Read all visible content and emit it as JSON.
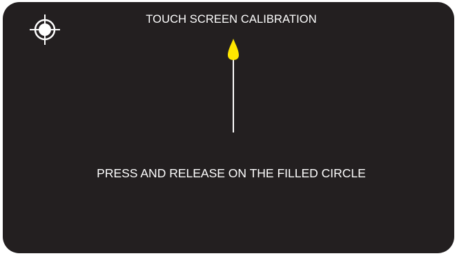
{
  "screen": {
    "title": "TOUCH SCREEN CALIBRATION",
    "instruction": "PRESS AND RELEASE ON THE FILLED CIRCLE",
    "target_icon": "crosshair-filled-circle-icon",
    "pointer_icon": "up-arrow-icon"
  },
  "colors": {
    "background": "#231f20",
    "text": "#ffffff",
    "target": "#ffffff",
    "arrow_head": "#ffe600",
    "arrow_line": "#ffffff"
  }
}
